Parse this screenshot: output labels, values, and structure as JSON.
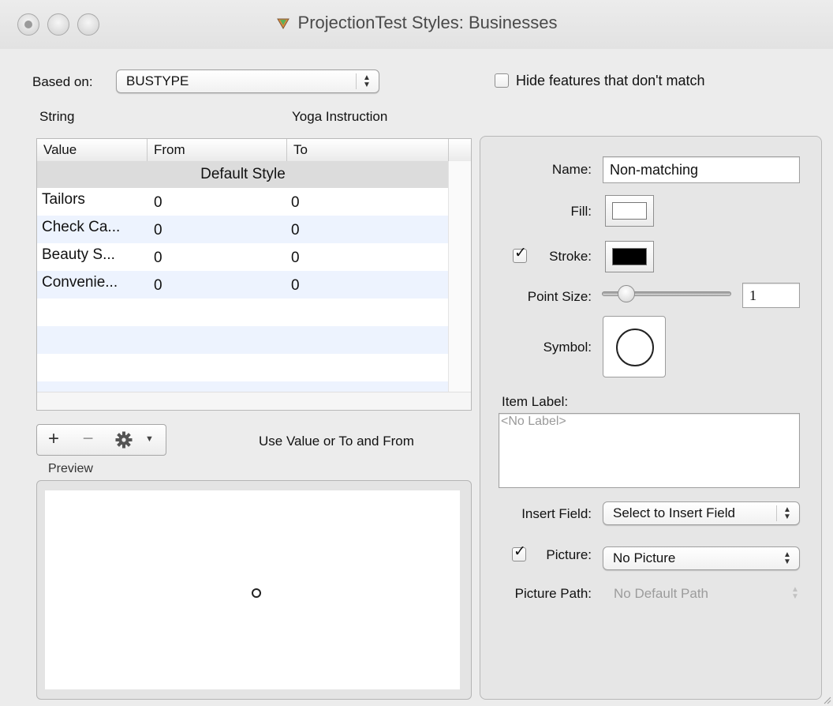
{
  "window": {
    "title": "ProjectionTest Styles: Businesses"
  },
  "top": {
    "based_on_label": "Based on:",
    "based_on_value": "BUSTYPE",
    "hide_features_label": "Hide features that don't match",
    "hide_features_checked": false,
    "string_label": "String",
    "instruction_label": "Yoga Instruction"
  },
  "table": {
    "columns": [
      "Value",
      "From",
      "To"
    ],
    "default_row": "Default Style",
    "rows": [
      {
        "value": "Tailors",
        "from": "0",
        "to": "0"
      },
      {
        "value": "Check Ca...",
        "from": "0",
        "to": "0"
      },
      {
        "value": "Beauty S...",
        "from": "0",
        "to": "0"
      },
      {
        "value": "Convenie...",
        "from": "0",
        "to": "0"
      }
    ]
  },
  "controls": {
    "add_label": "+",
    "remove_label": "−",
    "gear_icon": "gear-icon",
    "hint": "Use Value or To and From",
    "preview_label": "Preview"
  },
  "style": {
    "name_label": "Name:",
    "name_value": "Non-matching",
    "fill_label": "Fill:",
    "fill_color": "#ffffff",
    "stroke_label": "Stroke:",
    "stroke_checked": true,
    "stroke_color": "#000000",
    "point_size_label": "Point Size:",
    "point_size_value": "1",
    "symbol_label": "Symbol:",
    "symbol_icon": "circle-symbol-icon",
    "item_label_label": "Item Label:",
    "item_label_placeholder": "<No Label>",
    "insert_field_label": "Insert Field:",
    "insert_field_value": "Select to Insert Field",
    "picture_label": "Picture:",
    "picture_checked": true,
    "picture_value": "No Picture",
    "picture_path_label": "Picture Path:",
    "picture_path_value": "No Default Path"
  }
}
